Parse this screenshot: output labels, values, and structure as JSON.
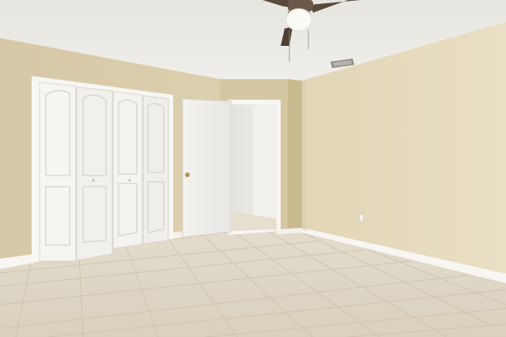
{
  "scene": {
    "colors": {
      "ceiling": "#ebe9e3",
      "wall_left": "#d9ccab",
      "wall_right": "#e4d9bb",
      "wall_recess": "#cfc09a",
      "hallway": "#eceae6",
      "floor": "#ddd5c4",
      "tile_line": "#cfc5b1",
      "trim": "#f7f6f2",
      "door": "#f5f4f0",
      "fan": "#5a4a3c"
    }
  }
}
